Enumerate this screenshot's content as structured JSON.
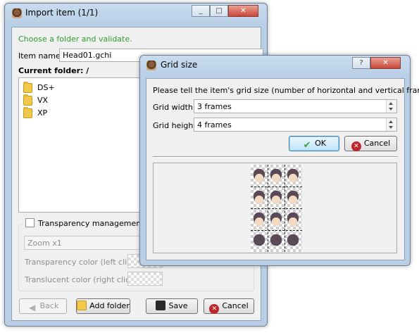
{
  "import_window": {
    "title": "Import item (1/1)",
    "caption_buttons": [
      "_",
      "□",
      "✕"
    ],
    "instruction": "Choose a folder and validate.",
    "item_name_label": "Item name",
    "item_name_value": "Head01.gchi",
    "current_folder_label": "Current folder: /",
    "folders": [
      "DS+",
      "VX",
      "XP"
    ],
    "transparency_label": "Transparency management",
    "zoom_value": "Zoom x1",
    "transparency_color_label": "Transparency color (left click)",
    "translucent_color_label": "Translucent color (right click)",
    "buttons": {
      "back": "Back",
      "add_folder": "Add folder",
      "save": "Save",
      "cancel": "Cancel"
    }
  },
  "grid_dialog": {
    "title": "Grid size",
    "help_button": "?",
    "close_button": "✕",
    "prompt": "Please tell the item's grid size (number of horizontal and vertical frames).",
    "grid_width_label": "Grid width",
    "grid_width_value": "3 frames",
    "grid_height_label": "Grid height",
    "grid_height_value": "4 frames",
    "ok_button": "OK",
    "cancel_button": "Cancel"
  },
  "colors": {
    "instruction_green": "#2e9b2e",
    "window_frame": "#b9cfe6",
    "ok_icon": "#3aa635",
    "cancel_icon": "#c0272d"
  },
  "icons": [
    "app-icon",
    "folder-icon",
    "checkmark-icon",
    "cancel-icon",
    "back-arrow-icon",
    "add-folder-icon",
    "save-icon",
    "help-icon",
    "close-icon"
  ]
}
